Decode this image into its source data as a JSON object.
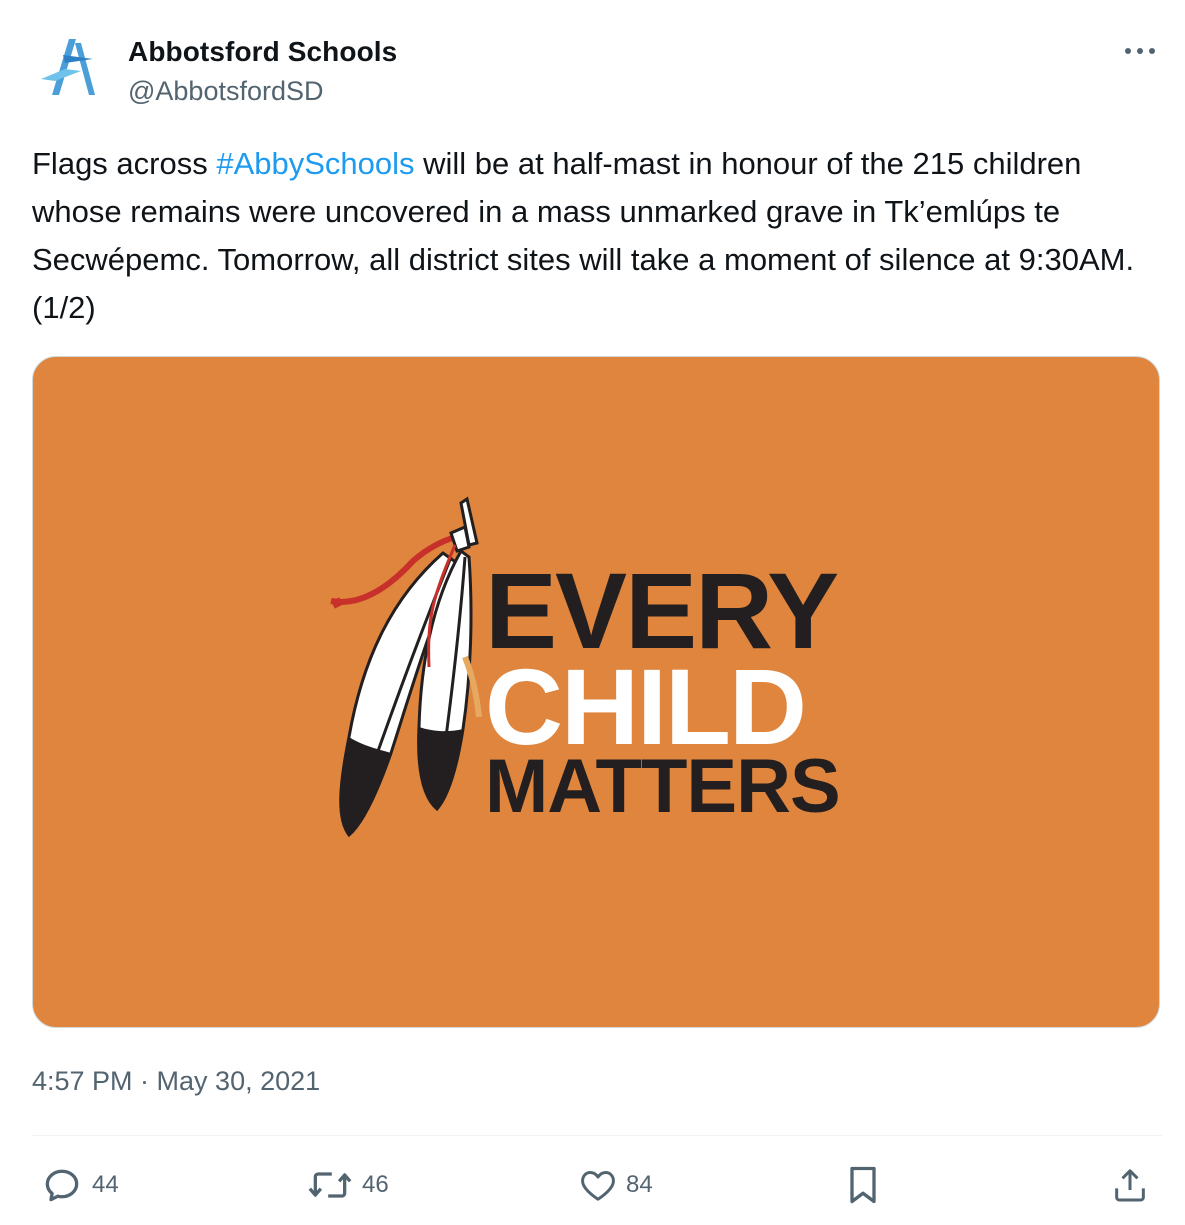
{
  "author": {
    "display_name": "Abbotsford Schools",
    "handle": "@AbbotsfordSD",
    "avatar_icon": "abbotsford-a-logo"
  },
  "tweet": {
    "text_before_hashtag": "Flags across ",
    "hashtag": "#AbbySchools",
    "text_after_hashtag": " will be at half-mast in honour of the 215 children whose remains were uncovered in a mass unmarked grave in Tk’emlúps te Secwépemc. Tomorrow, all district sites will take a moment of silence at 9:30AM. (1/2)",
    "timestamp": "4:57 PM · May 30, 2021"
  },
  "media": {
    "background_color": "#e0853d",
    "logo_lines": [
      "EVERY",
      "CHILD",
      "MATTERS"
    ]
  },
  "actions": {
    "reply_count": "44",
    "retweet_count": "46",
    "like_count": "84"
  },
  "colors": {
    "accent": "#1d9bf0",
    "secondary_text": "#536471"
  }
}
